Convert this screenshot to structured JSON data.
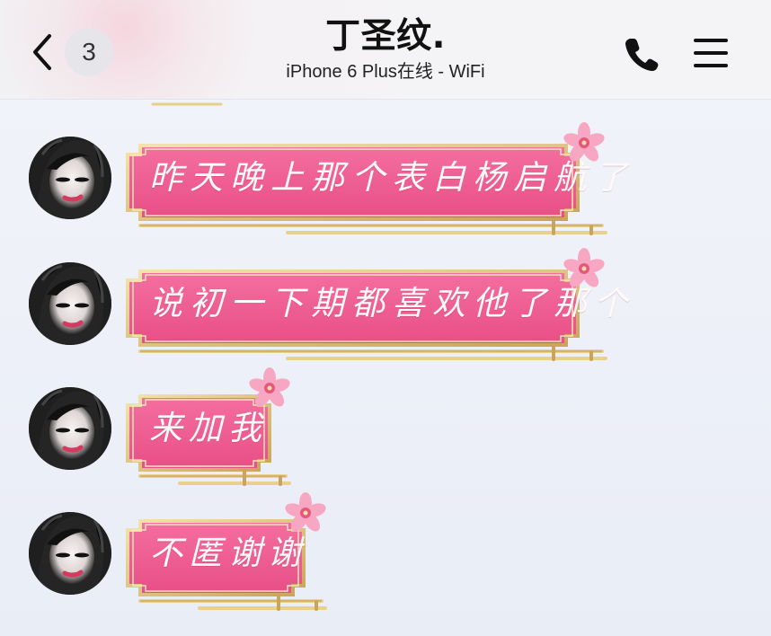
{
  "header": {
    "badge_count": "3",
    "title": "丁圣纹.",
    "subtitle": "iPhone 6 Plus在线 - WiFi"
  },
  "messages": [
    {
      "text": "昨天晚上那个表白杨启航了"
    },
    {
      "text": "说初一下期都喜欢他了那个"
    },
    {
      "text": "来加我"
    },
    {
      "text": "不匿谢谢"
    }
  ],
  "icons": {
    "back": "chevron-left-icon",
    "call": "phone-icon",
    "menu": "menu-icon",
    "decoration": "flower-icon"
  },
  "colors": {
    "bubble_fill": "#ef5f93",
    "bubble_border": "#d8b76a",
    "bubble_frame": "#f0dd9c",
    "flower": "#f7a8c4",
    "header_bg": "#f4f4f6",
    "chat_bg": "#ebeef7"
  }
}
